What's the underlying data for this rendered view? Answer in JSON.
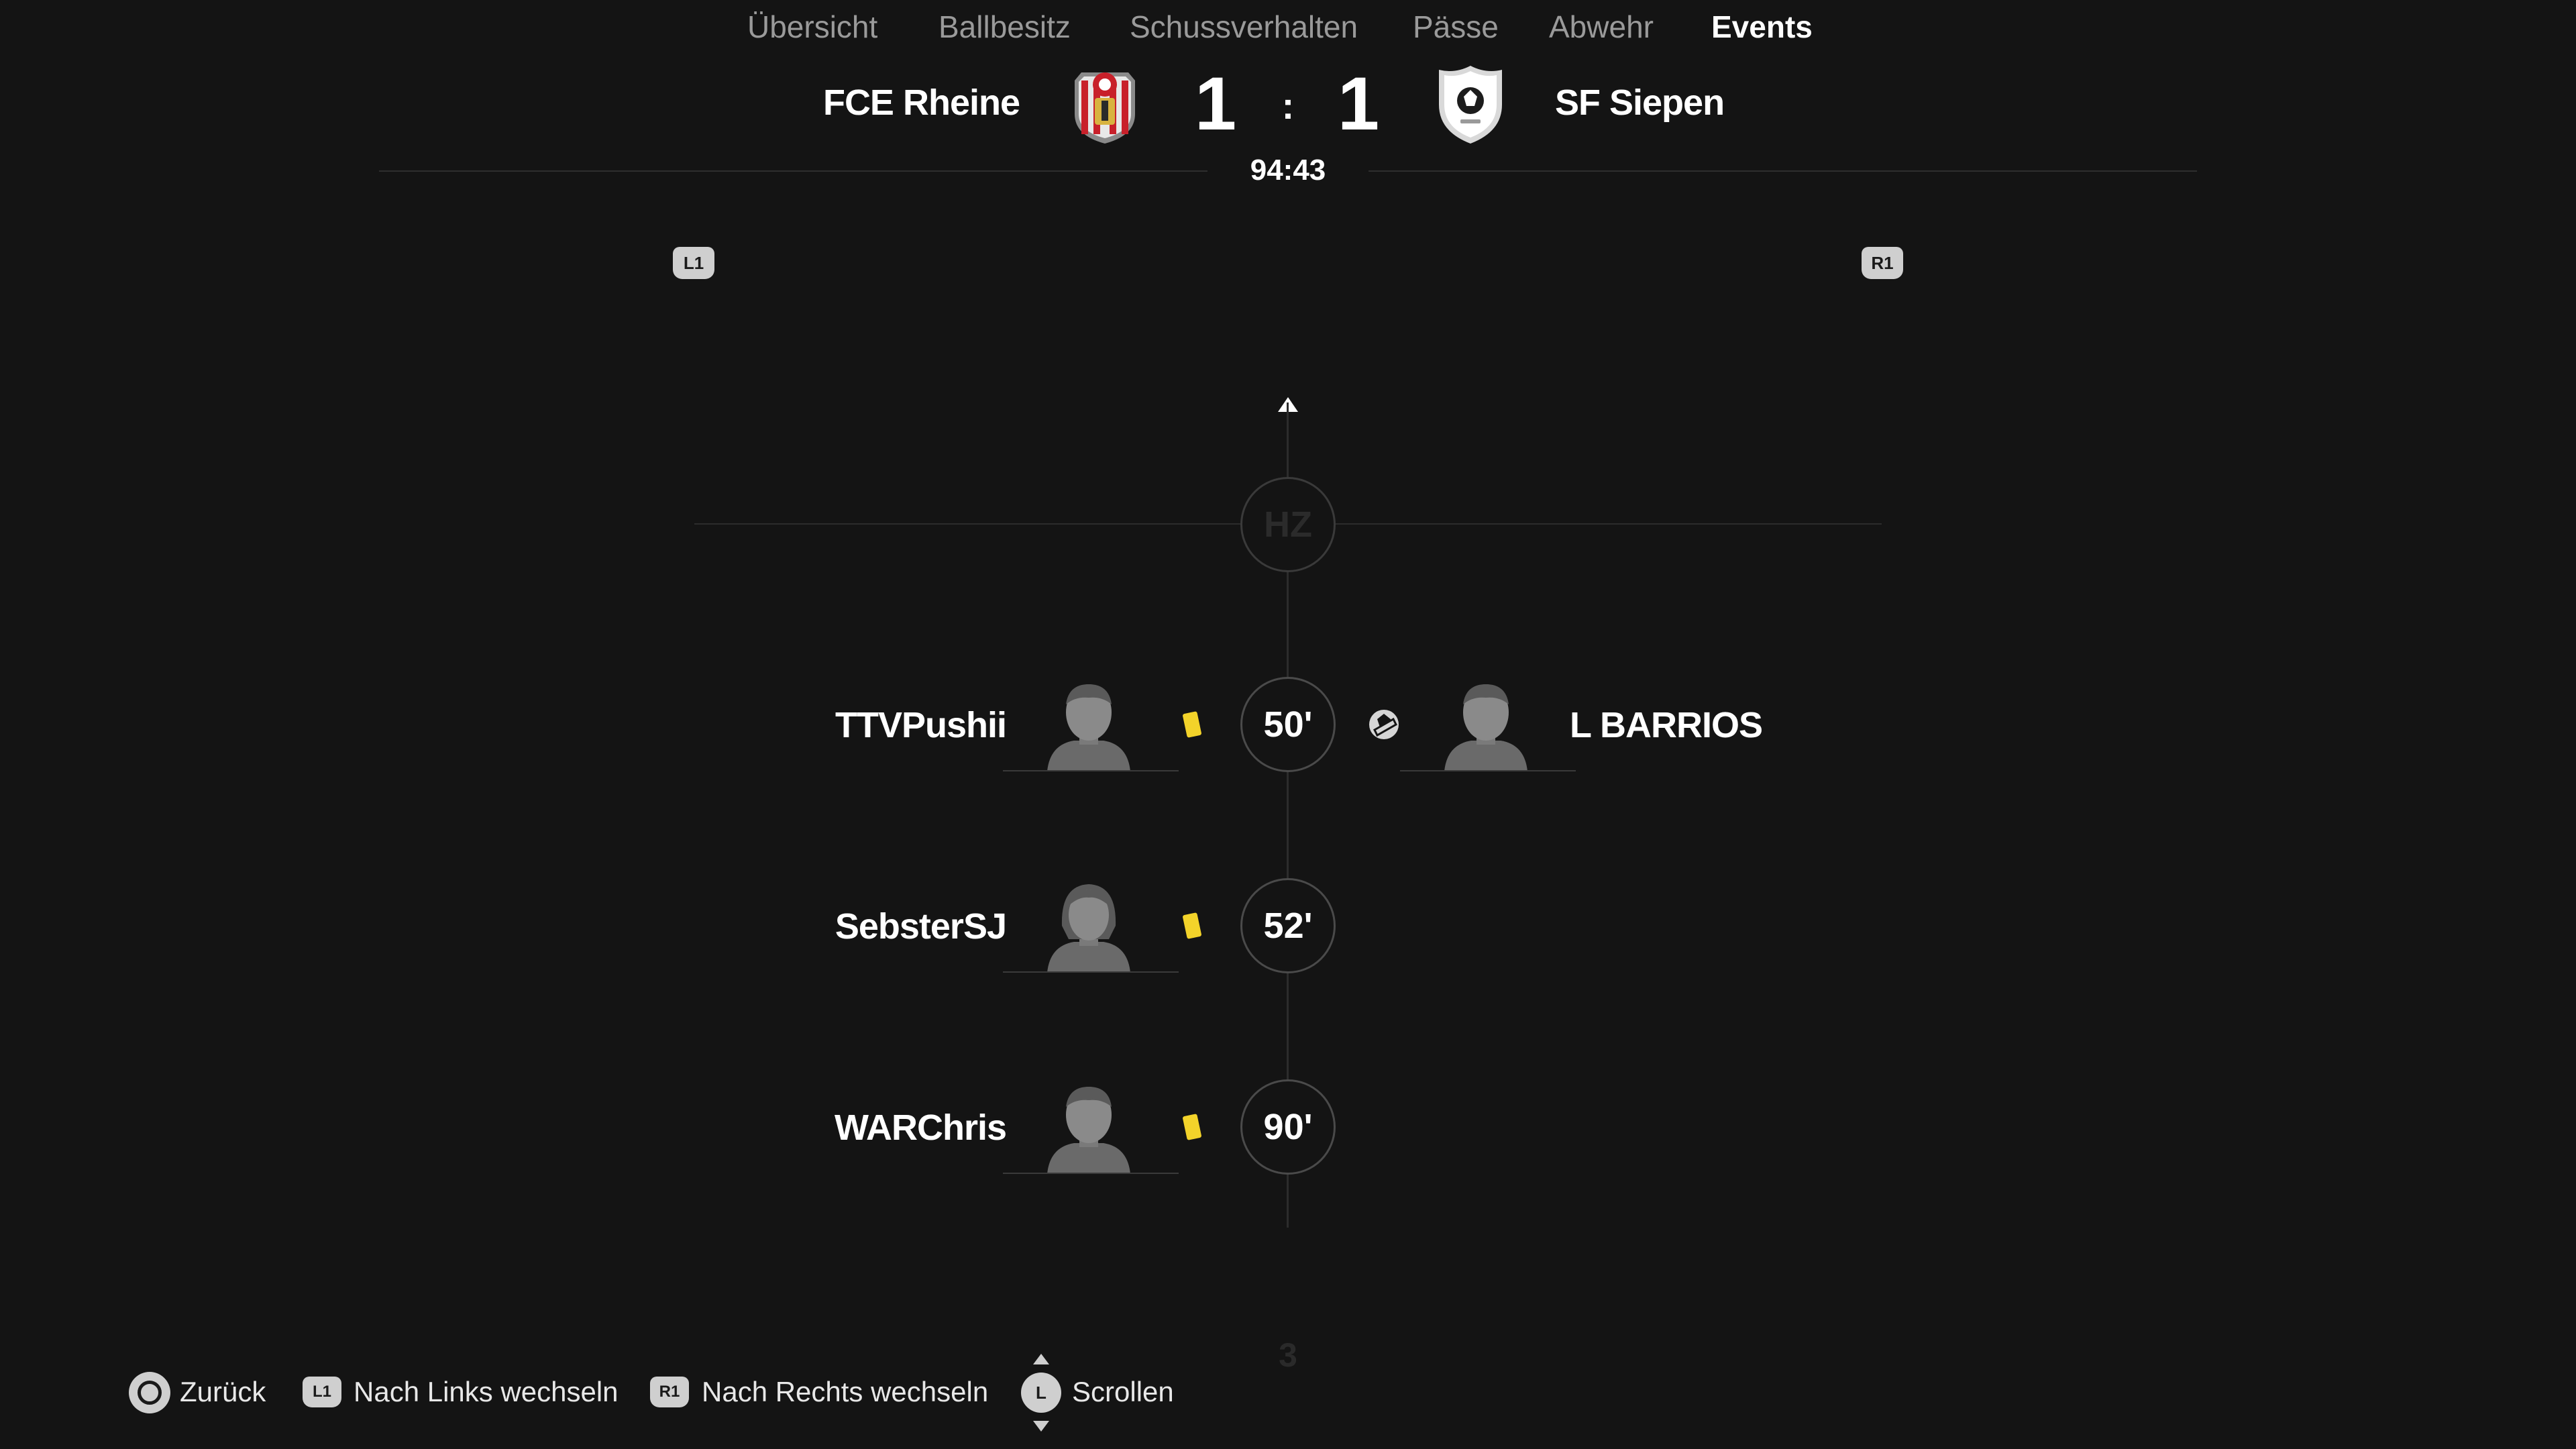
{
  "match": {
    "home_team": "FCE Rheine",
    "away_team": "SF Siepen",
    "home_score": "1",
    "away_score": "1",
    "separator": ":",
    "clock": "94:43"
  },
  "tabs": {
    "prev_button": "L1",
    "next_button": "R1",
    "items": [
      {
        "label": "Übersicht",
        "active": false
      },
      {
        "label": "Ballbesitz",
        "active": false
      },
      {
        "label": "Schussverhalten",
        "active": false
      },
      {
        "label": "Pässe",
        "active": false
      },
      {
        "label": "Abwehr",
        "active": false
      },
      {
        "label": "Events",
        "active": true
      }
    ]
  },
  "timeline": {
    "halftime_label": "HZ",
    "events": [
      {
        "minute": "50'",
        "home_player": "TTVPushii",
        "home_event": "yellow-card",
        "away_player": "L BARRIOS",
        "away_event": "injury"
      },
      {
        "minute": "52'",
        "home_player": "SebsterSJ",
        "home_event": "yellow-card"
      },
      {
        "minute": "90'",
        "home_player": "WARChris",
        "home_event": "yellow-card"
      }
    ],
    "faded_next": "3"
  },
  "footer": {
    "back_label": "Zurück",
    "left_button": "L1",
    "left_label": "Nach Links wechseln",
    "right_button": "R1",
    "right_label": "Nach Rechts wechseln",
    "stick_button": "L",
    "scroll_label": "Scrollen"
  },
  "colors": {
    "background": "#141414",
    "yellow_card": "#f3d32a",
    "inactive_tab": "#9a9a9a"
  }
}
